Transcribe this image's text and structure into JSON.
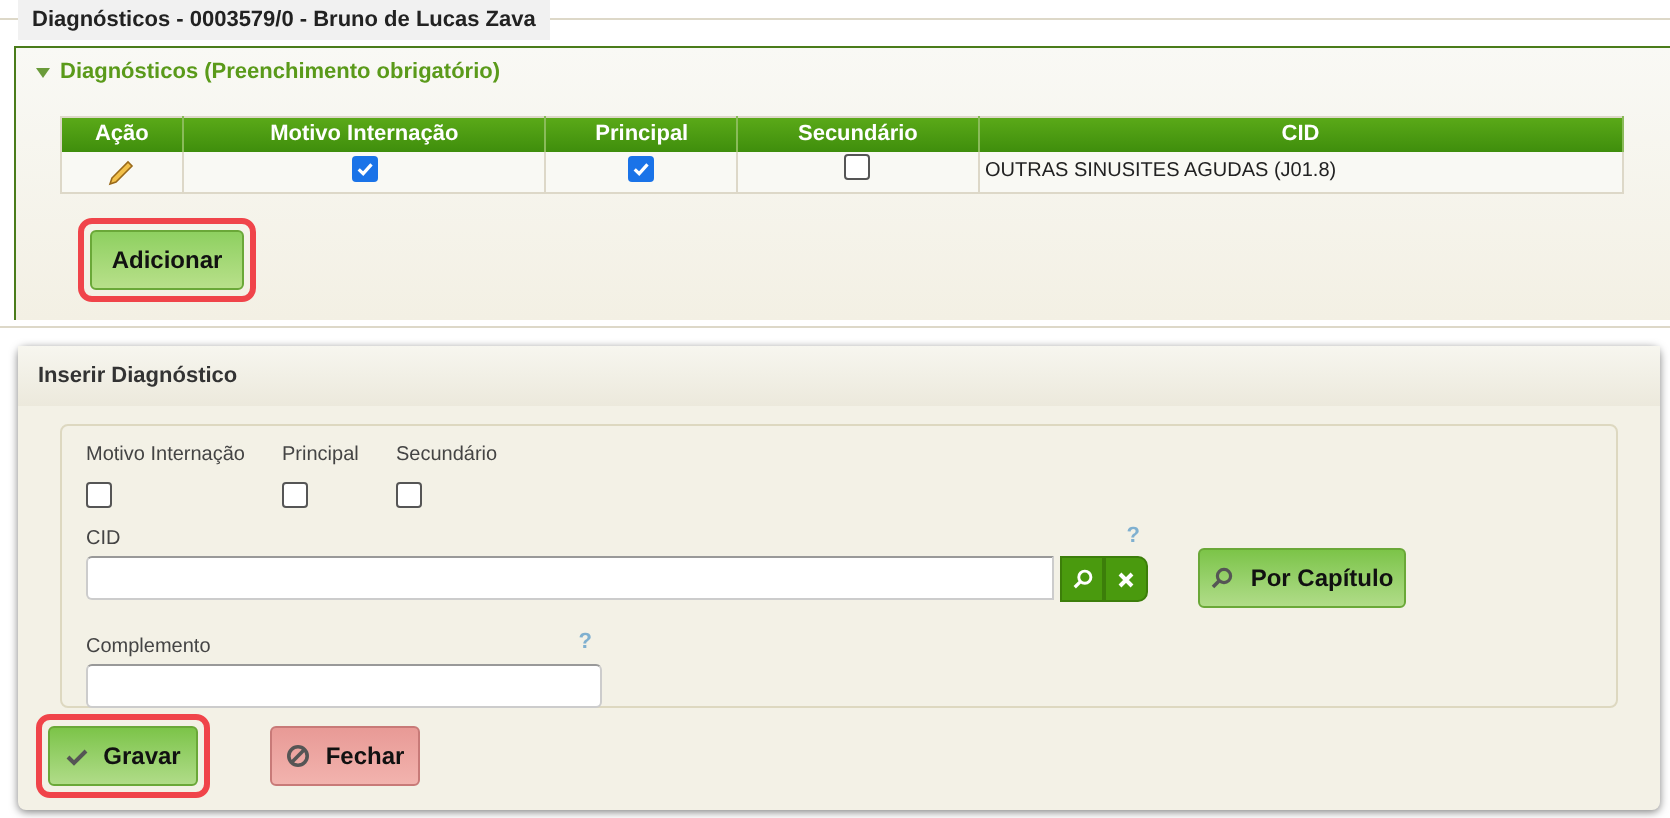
{
  "page_tab": {
    "title": "Diagnósticos - 0003579/0 - Bruno de Lucas Zava"
  },
  "section": {
    "title": "Diagnósticos (Preenchimento obrigatório)",
    "expanded": true,
    "table": {
      "columns": [
        "Ação",
        "Motivo Internação",
        "Principal",
        "Secundário",
        "CID"
      ],
      "rows": [
        {
          "motivo_internacao": true,
          "principal": true,
          "secundario": false,
          "cid": "OUTRAS SINUSITES AGUDAS (J01.8)"
        }
      ]
    },
    "add_button": {
      "label": "Adicionar",
      "highlighted": true
    }
  },
  "dialog": {
    "title": "Inserir Diagnóstico",
    "checkboxes": [
      {
        "label": "Motivo Internação",
        "checked": false
      },
      {
        "label": "Principal",
        "checked": false
      },
      {
        "label": "Secundário",
        "checked": false
      }
    ],
    "cid": {
      "label": "CID",
      "help": "?"
    },
    "chapter_button": {
      "label": "Por Capítulo"
    },
    "complemento": {
      "label": "Complemento",
      "help": "?"
    },
    "buttons": [
      {
        "label": "Gravar",
        "kind": "save",
        "highlighted": true
      },
      {
        "label": "Fechar",
        "kind": "close",
        "highlighted": false
      }
    ]
  }
}
